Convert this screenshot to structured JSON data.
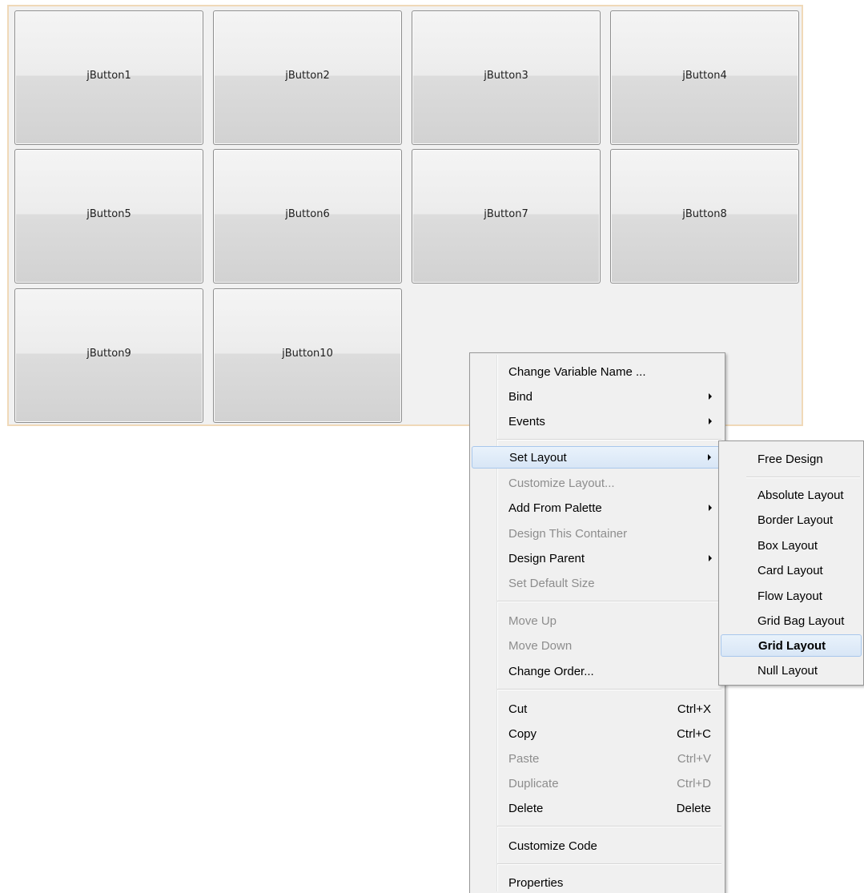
{
  "buttons": [
    "jButton1",
    "jButton2",
    "jButton3",
    "jButton4",
    "jButton5",
    "jButton6",
    "jButton7",
    "jButton8",
    "jButton9",
    "jButton10"
  ],
  "context_menu": {
    "items": [
      {
        "label": "Change Variable Name ...",
        "submenu": false,
        "enabled": true
      },
      {
        "label": "Bind",
        "submenu": true,
        "enabled": true
      },
      {
        "label": "Events",
        "submenu": true,
        "enabled": true
      },
      {
        "label": "Set Layout",
        "submenu": true,
        "enabled": true,
        "highlighted": true
      },
      {
        "label": "Customize Layout...",
        "submenu": false,
        "enabled": false
      },
      {
        "label": "Add From Palette",
        "submenu": true,
        "enabled": true
      },
      {
        "label": "Design This Container",
        "submenu": false,
        "enabled": false
      },
      {
        "label": "Design Parent",
        "submenu": true,
        "enabled": true
      },
      {
        "label": "Set Default Size",
        "submenu": false,
        "enabled": false
      },
      {
        "label": "Move Up",
        "submenu": false,
        "enabled": false
      },
      {
        "label": "Move Down",
        "submenu": false,
        "enabled": false
      },
      {
        "label": "Change Order...",
        "submenu": false,
        "enabled": true
      },
      {
        "label": "Cut",
        "shortcut": "Ctrl+X",
        "enabled": true
      },
      {
        "label": "Copy",
        "shortcut": "Ctrl+C",
        "enabled": true
      },
      {
        "label": "Paste",
        "shortcut": "Ctrl+V",
        "enabled": false
      },
      {
        "label": "Duplicate",
        "shortcut": "Ctrl+D",
        "enabled": false
      },
      {
        "label": "Delete",
        "shortcut": "Delete",
        "enabled": true
      },
      {
        "label": "Customize Code",
        "submenu": false,
        "enabled": true
      },
      {
        "label": "Properties",
        "submenu": false,
        "enabled": true
      }
    ]
  },
  "layout_submenu": {
    "items": [
      {
        "label": "Free Design"
      },
      {
        "label": "Absolute Layout"
      },
      {
        "label": "Border Layout"
      },
      {
        "label": "Box Layout"
      },
      {
        "label": "Card Layout"
      },
      {
        "label": "Flow Layout"
      },
      {
        "label": "Grid Bag Layout"
      },
      {
        "label": "Grid Layout",
        "highlighted": true
      },
      {
        "label": "Null Layout"
      }
    ]
  },
  "colors": {
    "panel_border": "#f0d9b8",
    "menu_background": "#f0f0f0",
    "highlight": "#d8e6f6",
    "disabled_text": "#8d8d8d"
  }
}
